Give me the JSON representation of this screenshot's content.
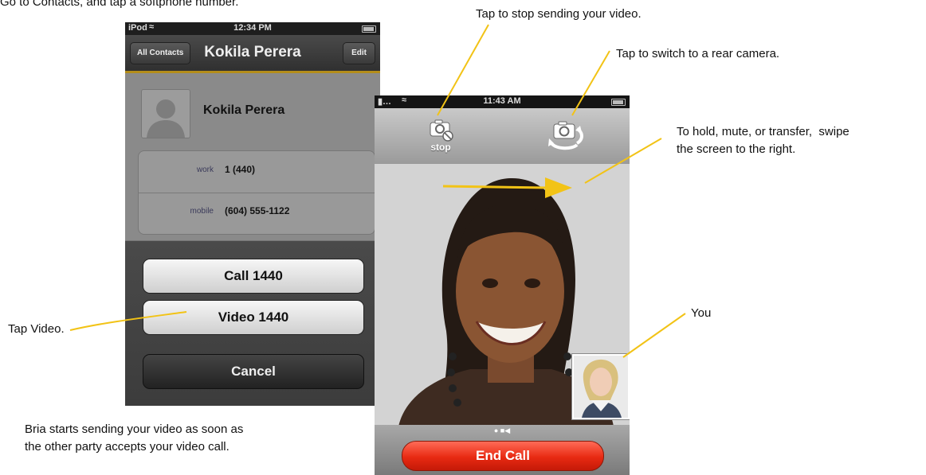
{
  "captions": {
    "step_top": "Go to Contacts, and tap a softphone number.",
    "stop_sending": "Tap to stop sending your video.",
    "switch_camera": "Tap to switch to a rear camera.",
    "swipe_line1": "To hold, mute, or transfer,  swipe",
    "swipe_line2": "the screen to the right.",
    "tap_video": "Tap Video.",
    "you": "You",
    "note_line1": "Bria starts sending your video as soon as",
    "note_line2": "the other party accepts your video call."
  },
  "contacts_phone": {
    "status": {
      "carrier": "iPod",
      "time": "12:34 PM"
    },
    "nav": {
      "back_label": "All Contacts",
      "title": "Kokila Perera",
      "edit_label": "Edit"
    },
    "contact_name": "Kokila Perera",
    "phones": [
      {
        "label": "work",
        "value": "1 (440)"
      },
      {
        "label": "mobile",
        "value": "(604) 555-1122"
      }
    ],
    "actions": {
      "call": "Call 1440",
      "video": "Video 1440",
      "cancel": "Cancel"
    }
  },
  "video_phone": {
    "status": {
      "time": "11:43 AM"
    },
    "stop_label": "stop",
    "end_call_label": "End Call"
  },
  "colors": {
    "callout_line": "#f2c316",
    "accent_gold": "#b48d1a",
    "end_call": "#e82a12"
  },
  "icons": [
    "wifi-icon",
    "battery-icon",
    "camera-stop-icon",
    "camera-switch-icon",
    "swipe-arrow-icon",
    "contact-avatar-icon"
  ]
}
